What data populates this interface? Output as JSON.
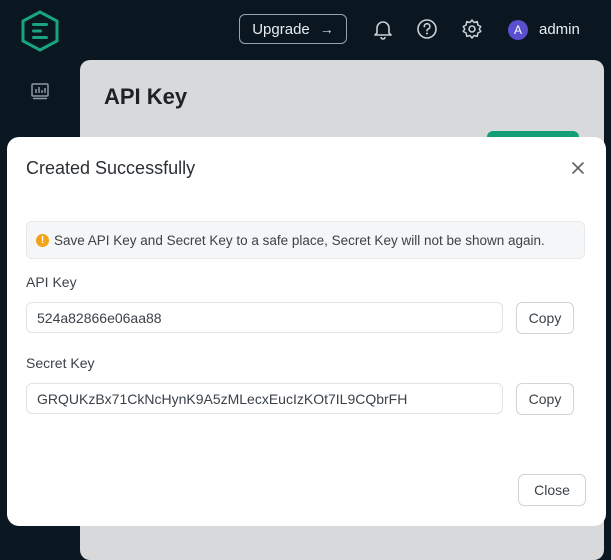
{
  "header": {
    "upgrade_label": "Upgrade",
    "avatar_initial": "A",
    "username": "admin",
    "icons": [
      "logo-icon",
      "bell-icon",
      "help-icon",
      "gear-icon",
      "arrow-right-icon"
    ]
  },
  "sidebar": {
    "icons": [
      "dashboard-icon"
    ]
  },
  "page": {
    "title": "API Key"
  },
  "modal": {
    "title": "Created Successfully",
    "alert_text": "Save API Key and Secret Key to a safe place, Secret Key will not be shown again.",
    "alert_icon": "warning-icon",
    "api_key_label": "API Key",
    "api_key_value": "524a82866e06aa88",
    "secret_key_label": "Secret Key",
    "secret_key_value": "GRQUKzBx71CkNcHynK9A5zMLecxEucIzKOt7IL9CQbrFH",
    "copy_label": "Copy",
    "close_label": "Close"
  },
  "colors": {
    "background": "#0a1720",
    "logo": "#1aa37f",
    "accent_green": "#129e77",
    "avatar": "#5a4fcf",
    "warning": "#f2a316"
  }
}
